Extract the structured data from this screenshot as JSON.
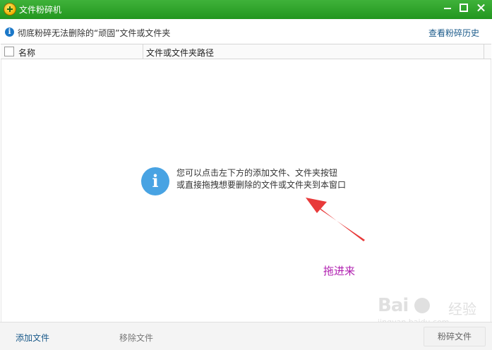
{
  "window": {
    "title": "文件粉碎机",
    "icons": {
      "logo": "app-logo-icon",
      "minimize": "minimize-icon",
      "maximize": "maximize-icon",
      "close": "close-icon"
    }
  },
  "infobar": {
    "icon": "info-icon",
    "text": "彻底粉碎无法删除的“顽固”文件或文件夹",
    "history_link": "查看粉碎历史"
  },
  "table": {
    "columns": [
      "名称",
      "文件或文件夹路径"
    ]
  },
  "empty_state": {
    "icon": "info-icon",
    "line1": "您可以点击左下方的添加文件、文件夹按钮",
    "line2": "或直接拖拽想要删除的文件或文件夹到本窗口"
  },
  "annotation": {
    "label": "拖进来",
    "color": "#b020b0",
    "arrow_color": "#e83a3a"
  },
  "watermark": {
    "logo": "Bai",
    "brand": "经验",
    "url": "jingyan.baidu.com"
  },
  "footer": {
    "add_files": "添加文件",
    "remove_files": "移除文件",
    "shred_button": "粉碎文件"
  },
  "colors": {
    "titlebar": "#2aa226",
    "link": "#1a5a8a",
    "info_icon": "#48a3e3"
  }
}
